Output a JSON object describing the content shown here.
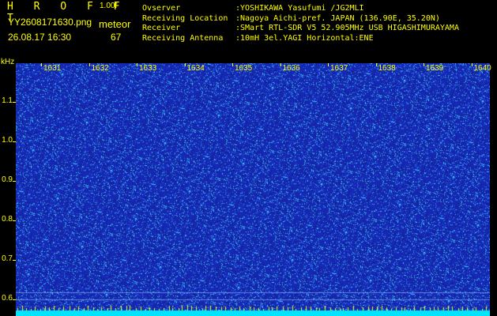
{
  "header": {
    "brand": "H R O F F T",
    "version": "1.00f",
    "filename": "YY2608171630.png",
    "mode": "meteor",
    "timestamp": "26.08.17 16:30",
    "count": "67"
  },
  "info": [
    {
      "label": "Ovserver",
      "value": ":YOSHIKAWA Yasufumi /JG2MLI"
    },
    {
      "label": "Receiving Location",
      "value": ":Nagoya Aichi-pref. JAPAN (136.90E, 35.20N)"
    },
    {
      "label": "Receiver",
      "value": ":SMart RTL-SDR V5 52.905MHz USB HIGASHIMURAYAMA"
    },
    {
      "label": "Receiving Antenna",
      "value": ":10mH 3el.YAGI Horizontal:ENE"
    }
  ],
  "axis": {
    "y_unit": "kHz",
    "y_ticks": [
      "1.1",
      "1.0",
      "0.9",
      "0.8",
      "0.7",
      "0.6"
    ],
    "x_ticks": [
      "1631",
      "1632",
      "1633",
      "1634",
      "1635",
      "1636",
      "1637",
      "1638",
      "1639",
      "1640"
    ]
  },
  "colors": {
    "label": "#ffff00",
    "waterfall_bg": "#1a2fa8",
    "noise_dot": "#39c6ff",
    "baseline": "#00e5ff"
  }
}
